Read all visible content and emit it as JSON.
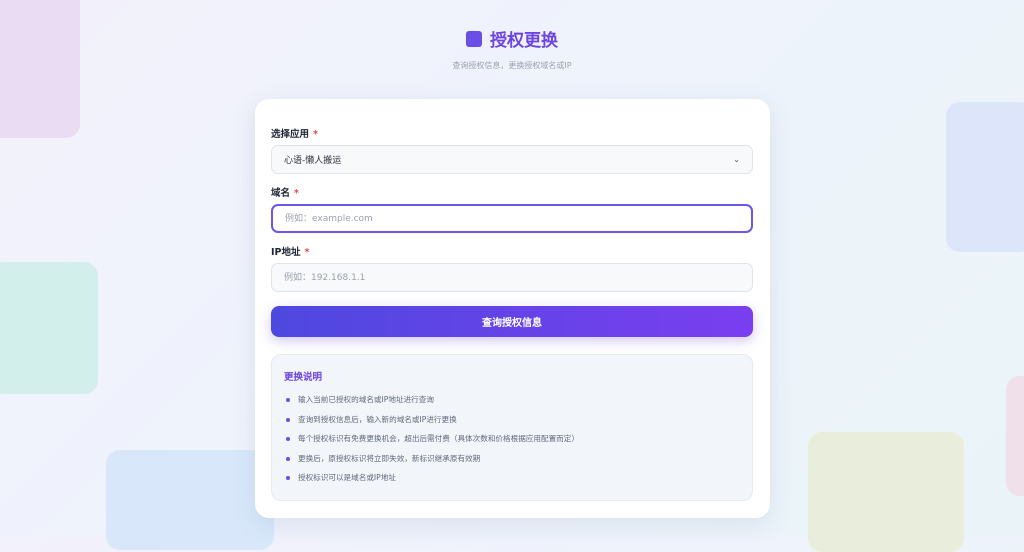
{
  "header": {
    "title": "授权更换",
    "subtitle": "查询授权信息，更换授权域名或IP"
  },
  "form": {
    "app_label": "选择应用",
    "app_selected": "心语-懒人搬运",
    "domain_label": "域名",
    "domain_placeholder": "例如：example.com",
    "ip_label": "IP地址",
    "ip_placeholder": "例如：192.168.1.1",
    "required_mark": "*",
    "submit_label": "查询授权信息"
  },
  "notes": {
    "title": "更换说明",
    "items": [
      "输入当前已授权的域名或IP地址进行查询",
      "查询到授权信息后，输入新的域名或IP进行更换",
      "每个授权标识有免费更换机会，超出后需付费（具体次数和价格根据应用配置而定）",
      "更换后，原授权标识将立即失效，新标识继承原有效期",
      "授权标识可以是域名或IP地址"
    ]
  },
  "colors": {
    "accent": "#6d45e0",
    "button_start": "#4e48df",
    "button_end": "#7a3ef0",
    "required": "#e04a4a"
  },
  "icons": {
    "title_icon": "purple-square-icon",
    "select_icon": "chevron-down-icon",
    "bullet_icon": "dot-icon"
  }
}
